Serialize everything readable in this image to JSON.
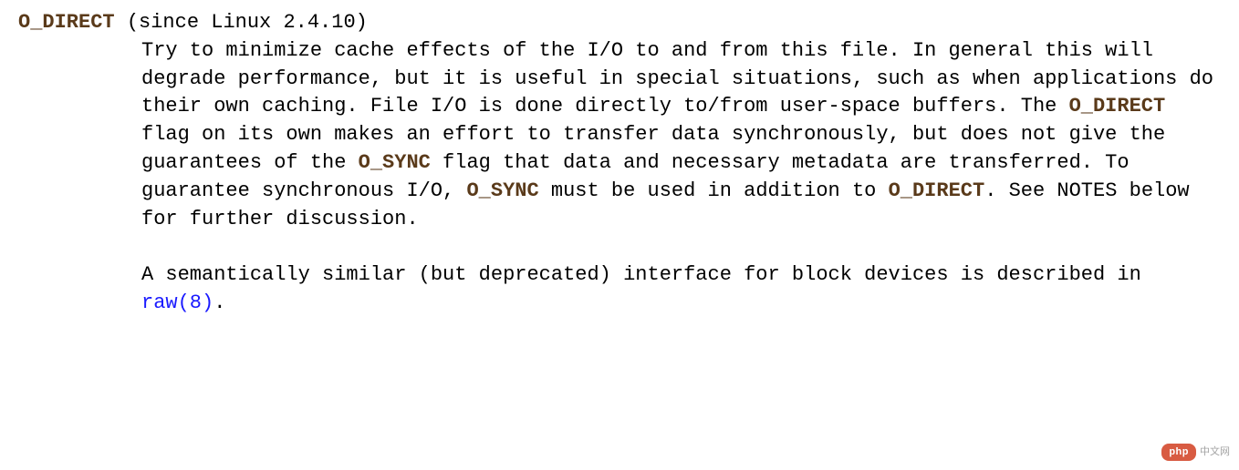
{
  "entry": {
    "flag": "O_DIRECT",
    "since": " (since Linux 2.4.10)",
    "para1": {
      "t1": "Try to minimize cache effects of the I/O to and from this file.  In general this will degrade performance, but it is useful in special situations, such as when applications do their own caching.  File I/O is done directly to/from user-space buffers.  The ",
      "f1": "O_DIRECT",
      "t2": " flag on its own makes an effort to transfer data synchronously, but does not give the guarantees of the ",
      "f2": "O_SYNC",
      "t3": " flag that data and necessary metadata are transferred.  To guarantee synchronous I/O, ",
      "f3": "O_SYNC",
      "t4": " must be used in addition to ",
      "f4": "O_DIRECT",
      "t5": ".  See NOTES below for further discussion."
    },
    "para2": {
      "t1": "A semantically similar (but deprecated) interface for block devices is described in ",
      "xref": "raw(8)",
      "t2": "."
    }
  },
  "watermark": {
    "pill": "php",
    "cn": "中文网"
  }
}
